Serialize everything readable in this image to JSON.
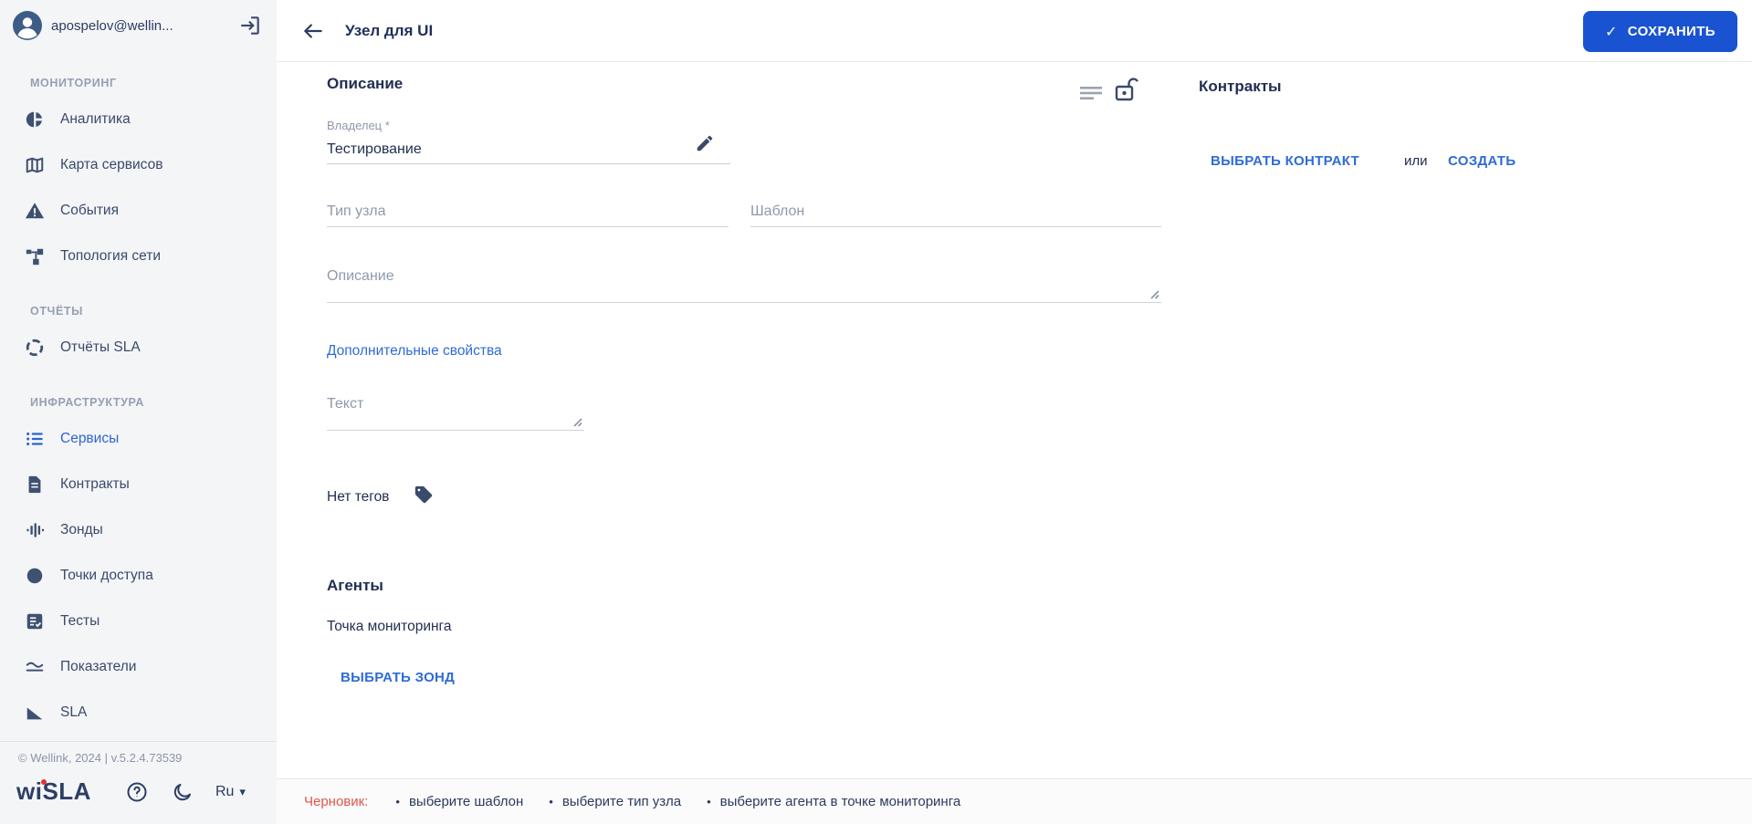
{
  "colors": {
    "accent_blue": "#1a53d1",
    "link_blue": "#2f6bd8",
    "status_red": "#e25549",
    "sidebar_active_blue": "#2e64cf",
    "logo_navy": "#2d3e66"
  },
  "icons": {
    "check": "✓",
    "caret_down": "▾",
    "bullet": "•"
  },
  "sidebar": {
    "user_email": "apospelov@wellin...",
    "sections": [
      {
        "label": "МОНИТОРИНГ",
        "items": [
          {
            "label": "Аналитика",
            "icon": "analytics-icon"
          },
          {
            "label": "Карта сервисов",
            "icon": "map-icon"
          },
          {
            "label": "События",
            "icon": "warning-icon"
          },
          {
            "label": "Топология сети",
            "icon": "topology-icon"
          }
        ]
      },
      {
        "label": "ОТЧЁТЫ",
        "items": [
          {
            "label": "Отчёты SLA",
            "icon": "sla-reports-icon"
          }
        ]
      },
      {
        "label": "ИНФРАСТРУКТУРА",
        "items": [
          {
            "label": "Сервисы",
            "icon": "services-icon",
            "active": true
          },
          {
            "label": "Контракты",
            "icon": "contracts-icon"
          },
          {
            "label": "Зонды",
            "icon": "probes-icon"
          },
          {
            "label": "Точки доступа",
            "icon": "access-points-icon"
          },
          {
            "label": "Тесты",
            "icon": "tests-icon"
          },
          {
            "label": "Показатели",
            "icon": "metrics-icon"
          },
          {
            "label": "SLA",
            "icon": "sla-icon"
          }
        ]
      }
    ],
    "copyright": "© Wellink, 2024 | v.5.2.4.73539",
    "logo_text": "wiSLA",
    "language": "Ru"
  },
  "header": {
    "title": "Узел для UI",
    "save_button": "СОХРАНИТЬ"
  },
  "form": {
    "section_title": "Описание",
    "owner": {
      "label": "Владелец *",
      "value": "Тестирование"
    },
    "node_type": {
      "placeholder": "Тип узла"
    },
    "template": {
      "placeholder": "Шаблон"
    },
    "description": {
      "placeholder": "Описание"
    },
    "additional_props_link": "Дополнительные свойства",
    "text_area": {
      "placeholder": "Текст"
    },
    "tags": {
      "empty_label": "Нет тегов"
    }
  },
  "agents": {
    "title": "Агенты",
    "monitoring_point_label": "Точка мониторинга",
    "select_probe_button": "ВЫБРАТЬ ЗОНД"
  },
  "contracts": {
    "title": "Контракты",
    "select_button": "ВЫБРАТЬ КОНТРАКТ",
    "or_label": "или",
    "create_button": "СОЗДАТЬ"
  },
  "statusbar": {
    "status_label": "Черновик:",
    "bullet": "•",
    "hints": [
      "выберите шаблон",
      "выберите тип узла",
      "выберите агента в точке мониторинга"
    ]
  }
}
